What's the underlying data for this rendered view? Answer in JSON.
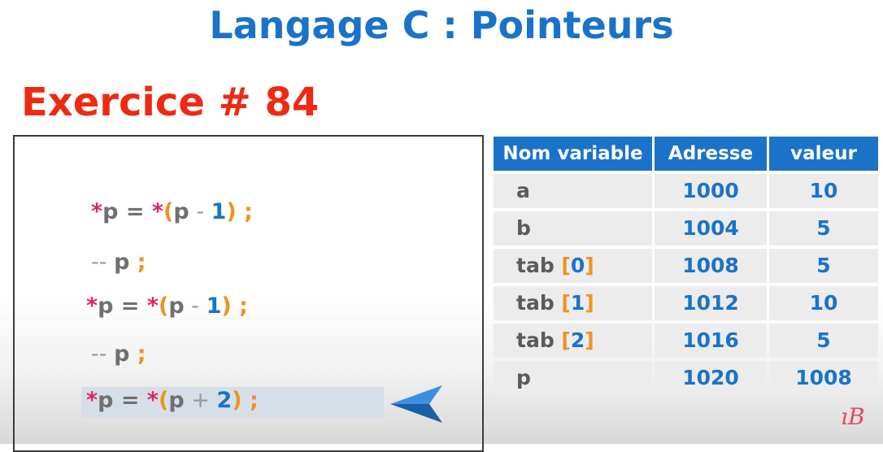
{
  "title": "Langage C : Pointeurs",
  "exercise": "Exercice # 84",
  "code": [
    {
      "star": "*",
      "pre": "p = ",
      "star2": "*",
      "open": "(",
      "var": "p",
      "op": " - ",
      "num": "1",
      "close": ")",
      "semi": " ;"
    },
    {
      "dec": "-- ",
      "var": "p",
      "semi": " ;"
    },
    {
      "star": "*",
      "pre": "p = ",
      "star2": "*",
      "open": "(",
      "var": "p",
      "op": " - ",
      "num": "1",
      "close": ")",
      "semi": " ;"
    },
    {
      "dec": "-- ",
      "var": "p",
      "semi": " ;"
    },
    {
      "star": "*",
      "pre": "p = ",
      "star2": "*",
      "open": "(",
      "var": "p",
      "op": " + ",
      "num": "2",
      "close": ")",
      "semi": " ;"
    }
  ],
  "table": {
    "headers": [
      "Nom variable",
      "Adresse",
      "valeur"
    ],
    "rows": [
      {
        "name": "a",
        "idx": "",
        "addr": "1000",
        "val": "10"
      },
      {
        "name": "b",
        "idx": "",
        "addr": "1004",
        "val": "5"
      },
      {
        "name": "tab ",
        "idx": "0",
        "addr": "1008",
        "val": "5"
      },
      {
        "name": "tab ",
        "idx": "1",
        "addr": "1012",
        "val": "10"
      },
      {
        "name": "tab ",
        "idx": "2",
        "addr": "1016",
        "val": "5"
      },
      {
        "name": "p",
        "idx": "",
        "addr": "1020",
        "val": "1008"
      }
    ]
  },
  "logo_text": "ıB",
  "colors": {
    "blue": "#1a73c8",
    "red": "#ee2a14",
    "orange": "#f0921e",
    "pink": "#e0245e"
  },
  "current_line_index": 4
}
